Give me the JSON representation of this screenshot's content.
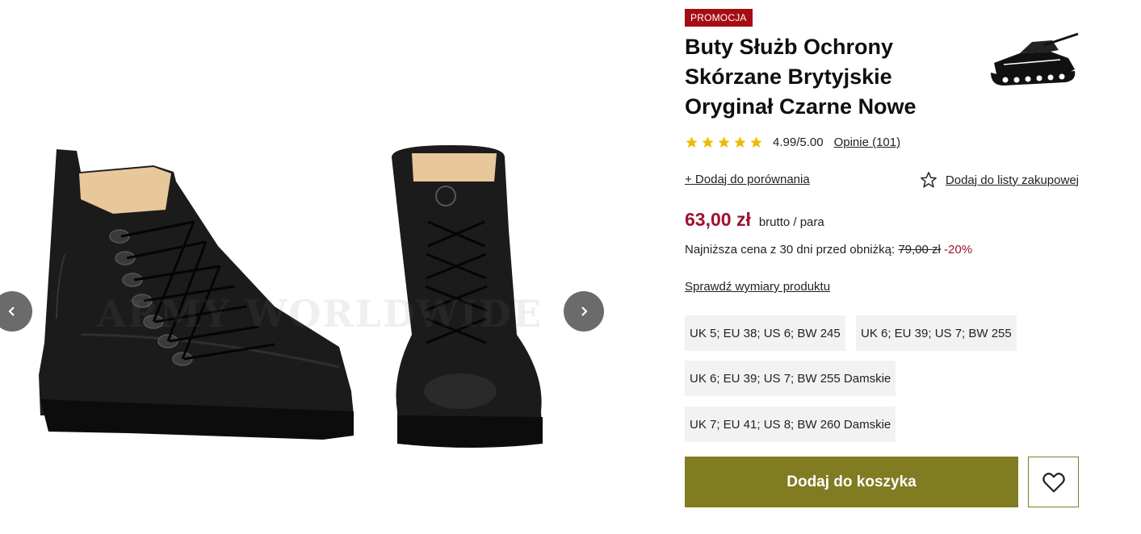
{
  "gallery": {
    "watermark": "ARMY WORLDWIDE",
    "prev_icon": "chevron-left-icon",
    "next_icon": "chevron-right-icon"
  },
  "product": {
    "badge": "PROMOCJA",
    "title": "Buty Służb Ochrony Skórzane Brytyjskie Oryginał Czarne Nowe",
    "logo_icon": "tank-logo-icon",
    "rating": {
      "stars": 5,
      "value": "4.99/5.00",
      "reviews": "Opinie (101)"
    },
    "compare_label": "+ Dodaj do porównania",
    "wishlist_label": "Dodaj do listy zakupowej",
    "price": "63,00 zł",
    "price_note": "brutto / para",
    "lowest_label": "Najniższa cena z 30 dni przed obniżką:",
    "old_price": "79,00 zł",
    "discount": "-20%",
    "dims_link": "Sprawdź wymiary produktu",
    "sizes": [
      "UK 5; EU 38; US 6; BW 245",
      "UK 6; EU 39; US 7; BW 255",
      "UK 6; EU 39; US 7; BW 255 Damskie",
      "UK 7; EU 41; US 8; BW 260 Damskie"
    ],
    "add_to_cart": "Dodaj do koszyka"
  },
  "colors": {
    "promo": "#a50d12",
    "price": "#9c1230",
    "cart": "#817b21",
    "star": "#f5b800"
  }
}
